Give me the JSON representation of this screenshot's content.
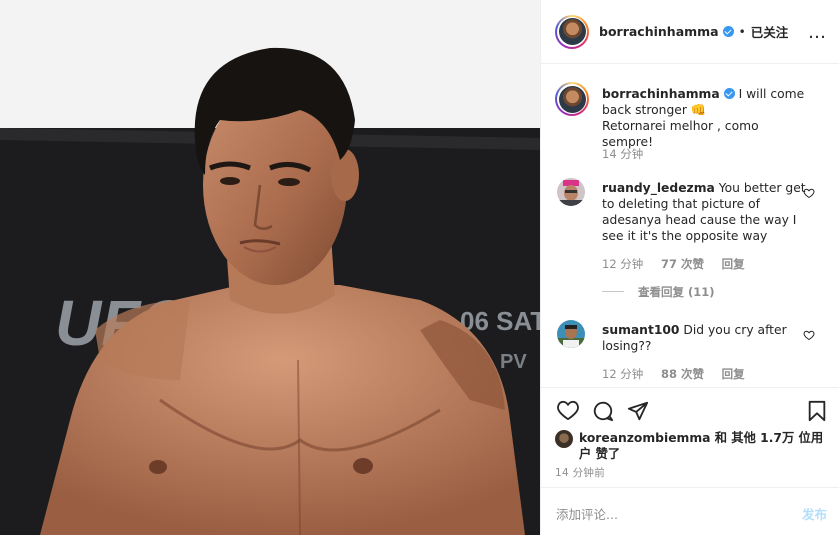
{
  "post": {
    "author": "borrachinhamma",
    "follow_label": "已关注",
    "dot": "•",
    "more_icon": "…"
  },
  "caption": {
    "username": "borrachinhamma",
    "line1": "I will come back stronger",
    "emoji": "👊",
    "line2": "Retornarei melhor , como sempre!",
    "time": "14 分钟"
  },
  "comments": [
    {
      "username": "ruandy_ledezma",
      "text": "You better get to deleting that picture of adesanya head cause the way I see it it's the opposite way",
      "time": "12 分钟",
      "likes": "77 次赞",
      "reply": "回复",
      "view_replies": "查看回复 (11)"
    },
    {
      "username": "sumant100",
      "text": "Did you cry after losing??",
      "time": "12 分钟",
      "likes": "88 次赞",
      "reply": "回复"
    }
  ],
  "liked_by": {
    "username": "koreanzombiemma",
    "text": "和 其他 1.7万 位用户 赞了"
  },
  "timestamp": "14 分钟前",
  "add_comment": {
    "placeholder": "添加评论...",
    "post_label": "发布"
  },
  "photo": {
    "banner_text": "UFC",
    "banner_date": "06 SAT",
    "banner_ppv": "PV"
  },
  "colors": {
    "verified": "#3897f0",
    "meta_gray": "#8e8e8e",
    "post_disabled": "#b2dffc"
  }
}
